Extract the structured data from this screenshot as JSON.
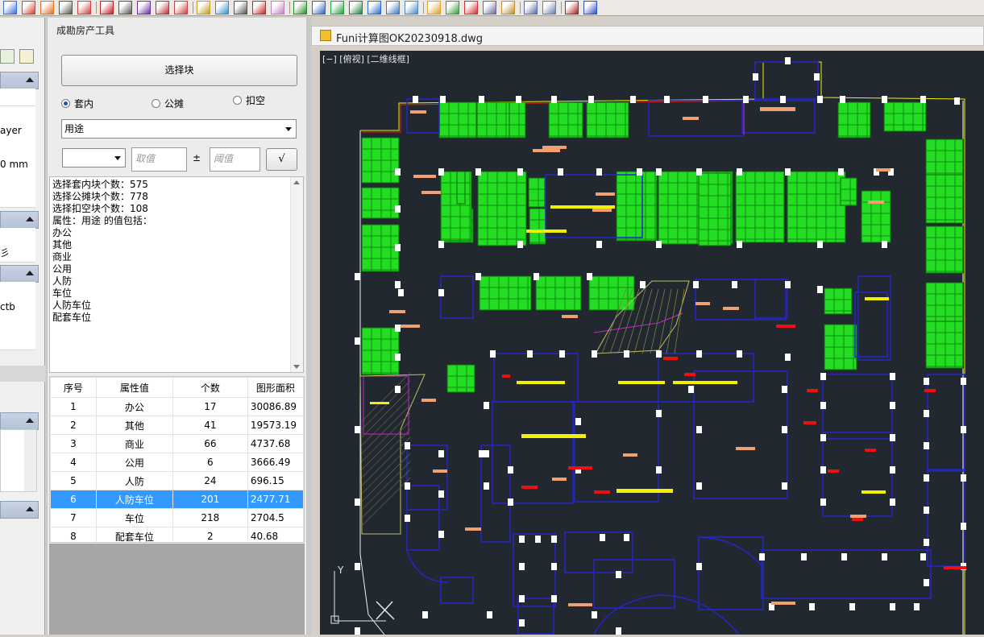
{
  "panel": {
    "title": "成勘房产工具",
    "select_button": "选择块",
    "radios": [
      {
        "label": "套内",
        "selected": true
      },
      {
        "label": "公摊",
        "selected": false
      },
      {
        "label": "扣空",
        "selected": false
      }
    ],
    "attribute_combo": "用途",
    "value_combo": "",
    "value_placeholder": "取值",
    "plusminus": "±",
    "threshold_placeholder": "阈值",
    "confirm_label": "√"
  },
  "info_lines": [
    "选择套内块个数：575",
    "选择公摊块个数：778",
    "选择扣空块个数：108",
    "属性：用途 的值包括：",
    "办公",
    "其他",
    "商业",
    "公用",
    "人防",
    "车位",
    "人防车位",
    "配套车位"
  ],
  "table": {
    "headers": [
      "序号",
      "属性值",
      "个数",
      "图形面积"
    ],
    "rows": [
      [
        "1",
        "办公",
        "17",
        "30086.89"
      ],
      [
        "2",
        "其他",
        "41",
        "19573.19"
      ],
      [
        "3",
        "商业",
        "66",
        "4737.68"
      ],
      [
        "4",
        "公用",
        "6",
        "3666.49"
      ],
      [
        "5",
        "人防",
        "24",
        "696.15"
      ],
      [
        "6",
        "人防车位",
        "201",
        "2477.71"
      ],
      [
        "7",
        "车位",
        "218",
        "2704.5"
      ],
      [
        "8",
        "配套车位",
        "2",
        "40.68"
      ]
    ],
    "selected_row": 6
  },
  "left_panel_rows": [
    "ayer",
    "0 mm",
    "彡",
    "ctb"
  ],
  "document": {
    "title": "Funi计算图OK20230918.dwg",
    "view_label": "[−] [俯视] [二维线框]",
    "axis_y": "Y"
  },
  "colors": {
    "canvas_bg": "#212830",
    "room_green": "#22dd22",
    "wall_blue": "#2525c8",
    "accent_yellow": "#f0f000",
    "accent_red": "#ee1010",
    "accent_orange": "#f0a070",
    "selection_blue": "#3399ff"
  }
}
